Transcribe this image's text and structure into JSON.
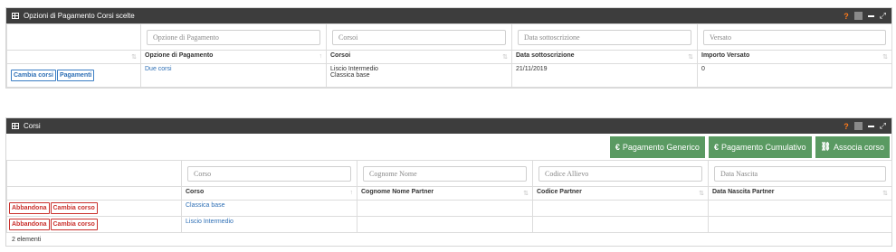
{
  "panel1": {
    "title": "Opzioni di Pagamento Corsi scelte",
    "filters": {
      "opzione": "Opzione di Pagamento",
      "corsi": "Corsoi",
      "data": "Data sottoscrizione",
      "versato": "Versato"
    },
    "headers": {
      "opzione": "Opzione di Pagamento",
      "corsi": "Corsoi",
      "data": "Data sottoscrizione",
      "importo": "Importo Versato"
    },
    "row": {
      "btn_cambia": "Cambia corsi",
      "btn_pagamenti": "Pagamenti",
      "opzione": "Due corsi",
      "corso1": "Liscio Intermedio",
      "corso2": "Classica base",
      "data": "21/11/2019",
      "importo": "0"
    }
  },
  "panel2": {
    "title": "Corsi",
    "actions": {
      "generico": "Pagamento Generico",
      "cumulativo": "Pagamento Cumulativo",
      "associa": "Associa corso"
    },
    "filters": {
      "corso": "Corso",
      "cognome": "Cognome Nome",
      "codice": "Codice Allievo",
      "nascita": "Data Nascita"
    },
    "headers": {
      "corso": "Corso",
      "cognome": "Cognome Nome Partner",
      "codice": "Codice Partner",
      "nascita": "Data Nascita Partner"
    },
    "rows": [
      {
        "btn_abbandona": "Abbandona",
        "btn_cambia": "Cambia corso",
        "corso": "Classica base"
      },
      {
        "btn_abbandona": "Abbandona",
        "btn_cambia": "Cambia corso",
        "corso": "Liscio Intermedio"
      }
    ],
    "footer": "2 elementi"
  },
  "icons": {
    "help": "?",
    "euro": "€",
    "link": "⛓",
    "expand": "⤢"
  },
  "colors": {
    "header_bg": "#3d3d3d",
    "green_button": "#5a9a62",
    "link_blue": "#2e6fb5",
    "danger_red": "#c9302c",
    "help_orange": "#ff7a1a"
  }
}
